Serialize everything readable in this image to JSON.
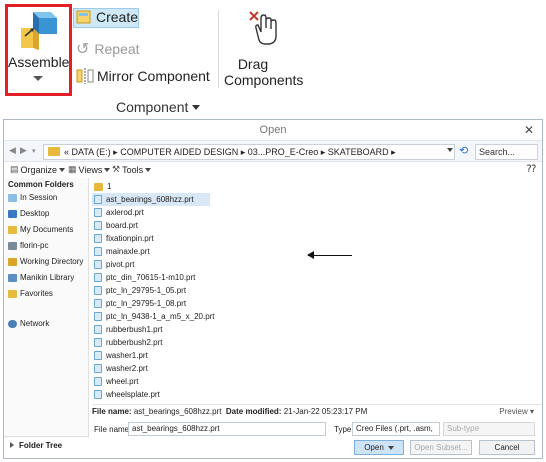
{
  "ribbon": {
    "assemble": "Assemble",
    "create": "Create",
    "repeat": "Repeat",
    "mirror": "Mirror Component",
    "drag_line1": "Drag",
    "drag_line2": "Components",
    "group": "Component"
  },
  "dialog": {
    "title": "Open",
    "close": "✕",
    "path": "« DATA (E:) ▸ COMPUTER AIDED DESIGN ▸ 03...PRO_E-Creo ▸ SKATEBOARD ▸",
    "search_placeholder": "Search...",
    "toolbar": {
      "organize": "Organize",
      "views": "Views",
      "tools": "Tools"
    },
    "left_pane": {
      "header": "Common Folders",
      "items": [
        "In Session",
        "Desktop",
        "My Documents",
        "florin-pc",
        "Working Directory",
        "Manikin Library",
        "Favorites",
        "Network"
      ]
    },
    "folder_tree": "Folder Tree",
    "folder_up": "1",
    "files": [
      "ast_bearings_608hzz.prt",
      "axlerod.prt",
      "board.prt",
      "fixationpin.prt",
      "mainaxle.prt",
      "pivot.prt",
      "ptc_din_70615-1-m10.prt",
      "ptc_ln_29795-1_05.prt",
      "ptc_ln_29795-1_08.prt",
      "ptc_ln_9438-1_a_m5_x_20.prt",
      "rubberbush1.prt",
      "rubberbush2.prt",
      "washer1.prt",
      "washer2.prt",
      "wheel.prt",
      "wheelsplate.prt"
    ],
    "info": {
      "file_name_label": "File name:",
      "file_name_value": "ast_bearings_608hzz.prt",
      "date_label": "Date modified:",
      "date_value": "21-Jan-22 05:23:17 PM",
      "preview": "Preview ▾"
    },
    "bottom": {
      "file_name_label": "File name:",
      "file_name_value": "ast_bearings_608hzz.prt",
      "type_label": "Type",
      "type_value": "Creo Files (.prt, .asm,",
      "subtype": "Sub-type",
      "open": "Open",
      "open_subset": "Open Subset...",
      "cancel": "Cancel"
    }
  },
  "colors": {
    "highlight_border": "#e21f26",
    "selection": "#d9e8f6",
    "accent": "#2a6fd1"
  }
}
